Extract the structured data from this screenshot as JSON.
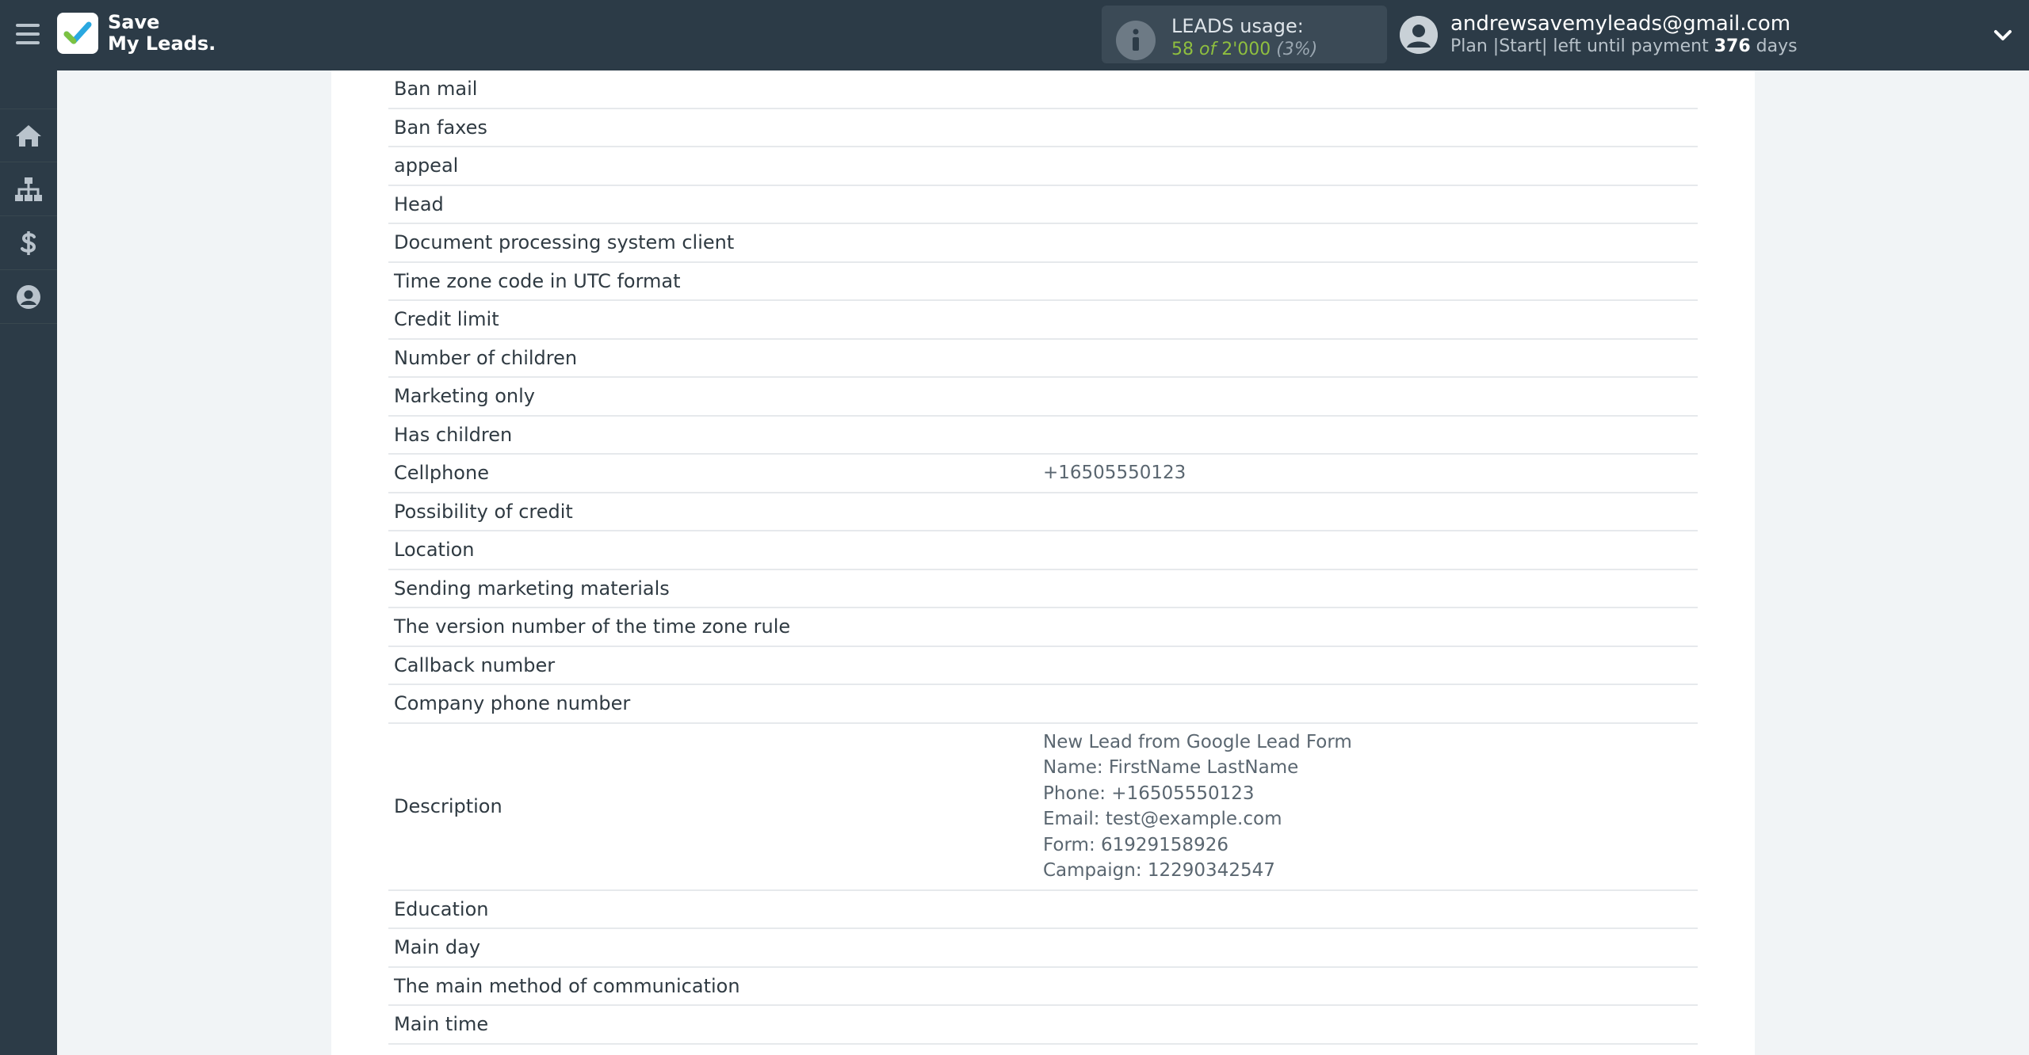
{
  "header": {
    "logo_line1": "Save",
    "logo_line2": "My Leads.",
    "usage_title": "LEADS usage:",
    "usage_used": "58",
    "usage_of": "of",
    "usage_total": "2'000",
    "usage_pct": "(3%)",
    "user_email": "andrewsavemyleads@gmail.com",
    "plan_text": "Plan |Start| left until payment",
    "days_left": "376",
    "days_label": "days"
  },
  "sidebar": {
    "items": [
      {
        "name": "home-icon"
      },
      {
        "name": "sitemap-icon"
      },
      {
        "name": "dollar-icon"
      },
      {
        "name": "user-circle-icon"
      }
    ]
  },
  "fields": [
    {
      "label": "Ban mail",
      "value": ""
    },
    {
      "label": "Ban faxes",
      "value": ""
    },
    {
      "label": "appeal",
      "value": ""
    },
    {
      "label": "Head",
      "value": ""
    },
    {
      "label": "Document processing system client",
      "value": ""
    },
    {
      "label": "Time zone code in UTC format",
      "value": ""
    },
    {
      "label": "Credit limit",
      "value": ""
    },
    {
      "label": "Number of children",
      "value": ""
    },
    {
      "label": "Marketing only",
      "value": ""
    },
    {
      "label": "Has children",
      "value": ""
    },
    {
      "label": "Cellphone",
      "value": "+16505550123"
    },
    {
      "label": "Possibility of credit",
      "value": ""
    },
    {
      "label": "Location",
      "value": ""
    },
    {
      "label": "Sending marketing materials",
      "value": ""
    },
    {
      "label": "The version number of the time zone rule",
      "value": ""
    },
    {
      "label": "Callback number",
      "value": ""
    },
    {
      "label": "Company phone number",
      "value": ""
    },
    {
      "label": "Description",
      "value": "New Lead from Google Lead Form\nName: FirstName LastName\nPhone: +16505550123\nEmail: test@example.com\nForm: 61929158926\nCampaign: 12290342547"
    },
    {
      "label": "Education",
      "value": ""
    },
    {
      "label": "Main day",
      "value": ""
    },
    {
      "label": "The main method of communication",
      "value": ""
    },
    {
      "label": "Main time",
      "value": ""
    }
  ]
}
